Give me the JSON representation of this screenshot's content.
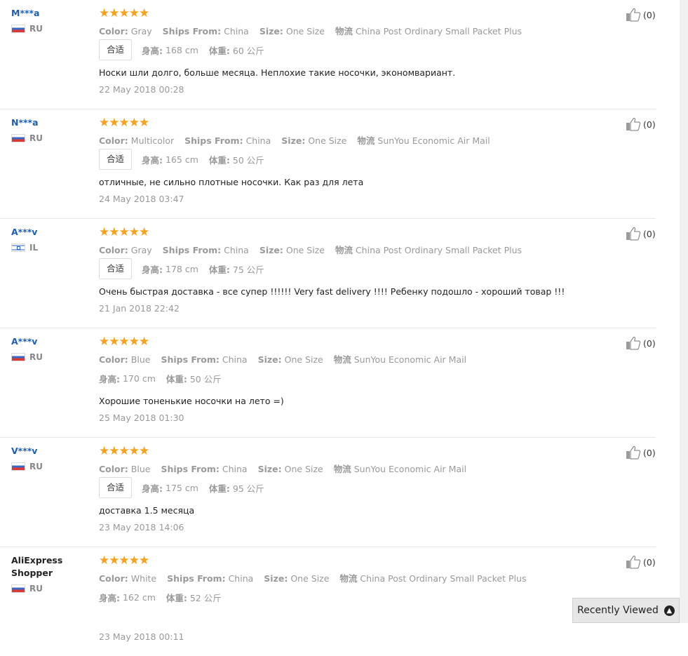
{
  "reviews": [
    {
      "user": "M***a",
      "country": "RU",
      "flag": "ru",
      "stars": 5,
      "color": "Gray",
      "ships_from": "China",
      "size": "One Size",
      "logistics": "China Post Ordinary Small Packet Plus",
      "fit": "合适",
      "height": "168 cm",
      "weight": "60 公斤",
      "text": "Носки шли долго, больше месяца. Неплохие такие носочки, экономвариант.",
      "date": "22 May 2018 00:28",
      "helpful": "(0)"
    },
    {
      "user": "N***a",
      "country": "RU",
      "flag": "ru",
      "stars": 5,
      "color": "Multicolor",
      "ships_from": "China",
      "size": "One Size",
      "logistics": "SunYou Economic Air Mail",
      "fit": "合适",
      "height": "165 cm",
      "weight": "50 公斤",
      "text": "отличные, не сильно плотные носочки. Как раз для лета",
      "date": "24 May 2018 03:47",
      "helpful": "(0)"
    },
    {
      "user": "A***v",
      "country": "IL",
      "flag": "il",
      "stars": 5,
      "color": "Gray",
      "ships_from": "China",
      "size": "One Size",
      "logistics": "China Post Ordinary Small Packet Plus",
      "fit": "合适",
      "height": "178 cm",
      "weight": "75 公斤",
      "text": "Очень быстрая доставка - все супер !!!!!! Very fast delivery !!!! Ребенку подошло - хороший товар !!!",
      "date": "21 Jan 2018 22:42",
      "helpful": "(0)"
    },
    {
      "user": "A***v",
      "country": "RU",
      "flag": "ru",
      "stars": 5,
      "color": "Blue",
      "ships_from": "China",
      "size": "One Size",
      "logistics": "SunYou Economic Air Mail",
      "fit": "",
      "height": "170 cm",
      "weight": "50 公斤",
      "text": "Хорошие тоненькие носочки на лето =)",
      "date": "25 May 2018 01:30",
      "helpful": "(0)"
    },
    {
      "user": "V***v",
      "country": "RU",
      "flag": "ru",
      "stars": 5,
      "color": "Blue",
      "ships_from": "China",
      "size": "One Size",
      "logistics": "SunYou Economic Air Mail",
      "fit": "合适",
      "height": "175 cm",
      "weight": "95 公斤",
      "text": "доставка 1.5 месяца",
      "date": "23 May 2018 14:06",
      "helpful": "(0)"
    },
    {
      "user": "AliExpress Shopper",
      "country": "RU",
      "flag": "ru",
      "stars": 5,
      "color": "White",
      "ships_from": "China",
      "size": "One Size",
      "logistics": "China Post Ordinary Small Packet Plus",
      "fit": "",
      "height": "162 cm",
      "weight": "52 公斤",
      "text": "",
      "date": "23 May 2018 00:11",
      "helpful": "(0)"
    }
  ],
  "labels": {
    "color": "Color:",
    "ships_from": "Ships From:",
    "size": "Size:",
    "logistics": "物流",
    "height": "身高:",
    "weight": "体重:"
  },
  "recently_viewed": "Recently Viewed",
  "colors": {
    "star": "#f7a21e",
    "username": "#1a5fb4"
  }
}
